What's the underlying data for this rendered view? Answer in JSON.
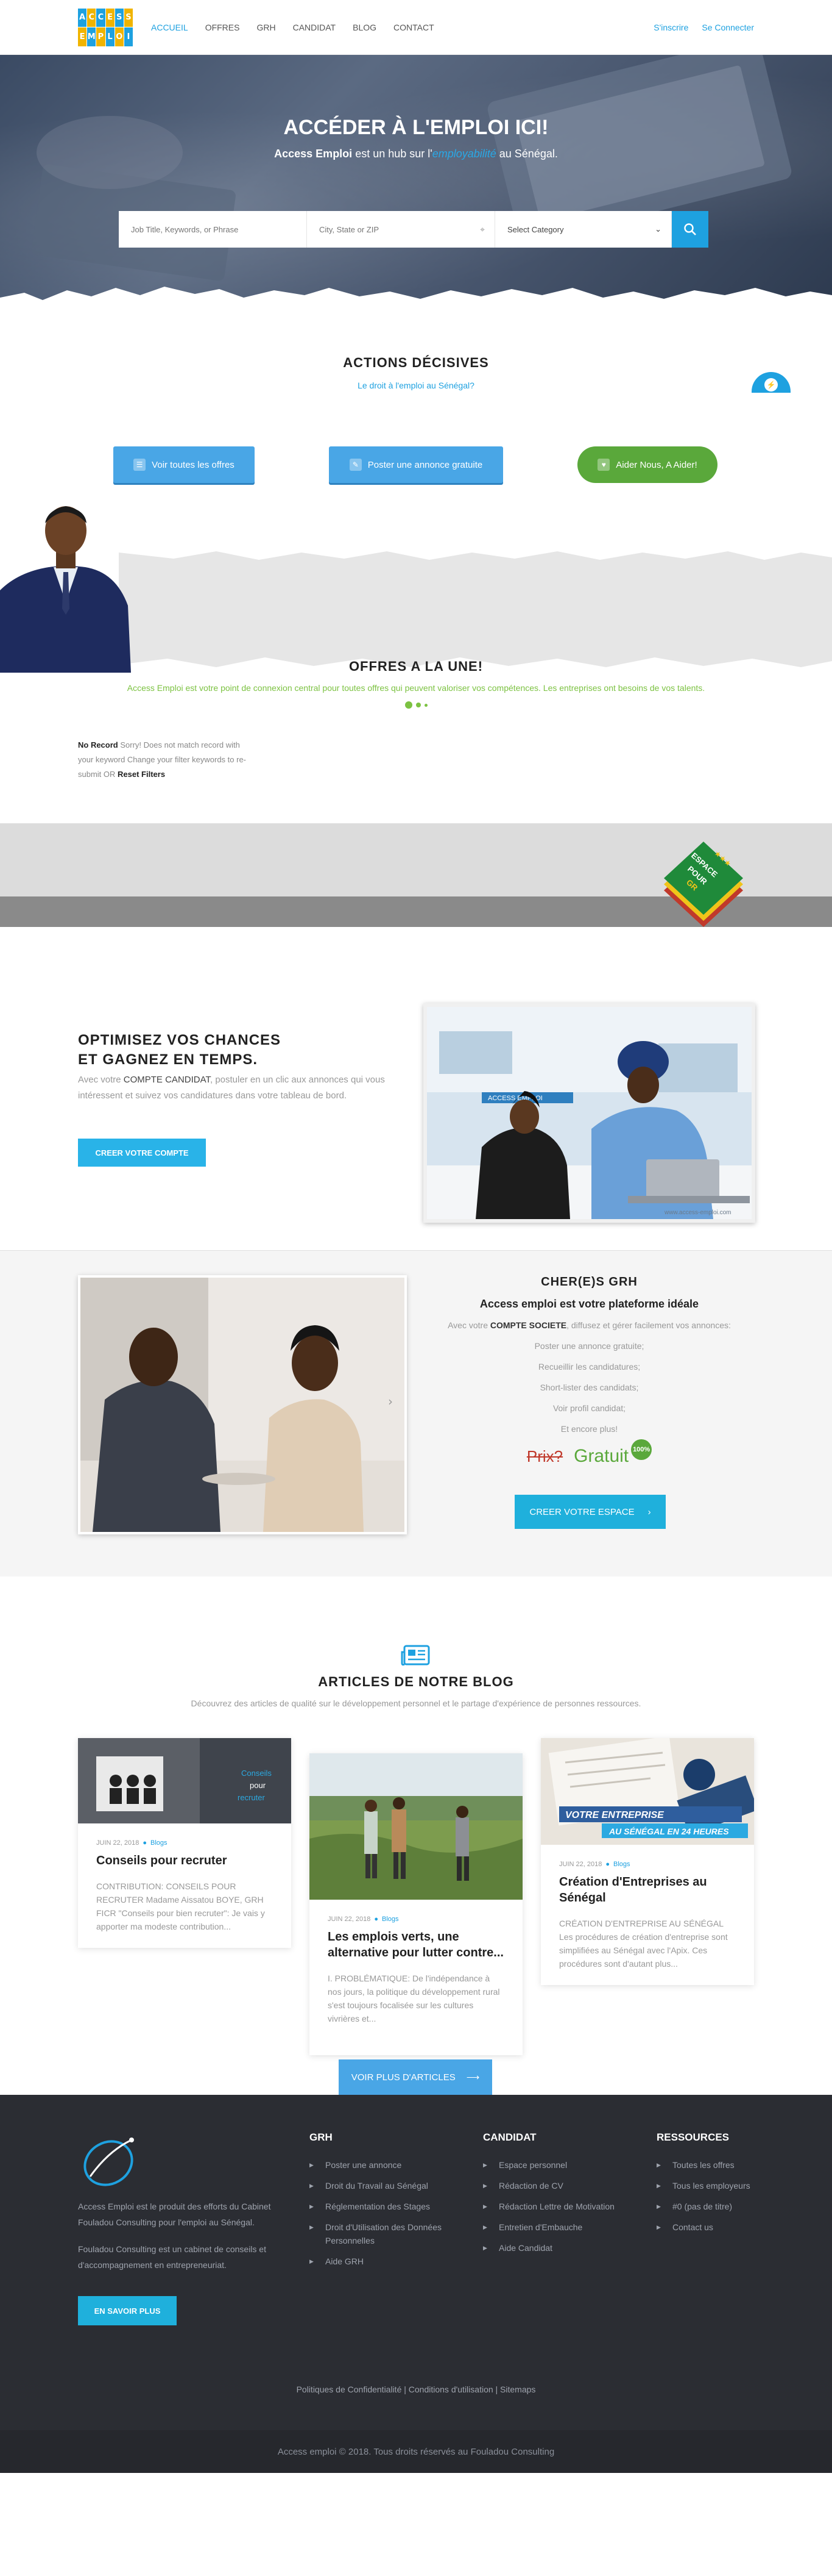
{
  "colors": {
    "accent": "#1ea1e0",
    "green": "#5aa83b",
    "footer": "#2b2d33"
  },
  "logo": {
    "line1": [
      "A",
      "C",
      "C",
      "E",
      "S",
      "S"
    ],
    "line2": [
      "E",
      "M",
      "P",
      "L",
      "O",
      "I"
    ]
  },
  "nav": {
    "items": [
      "ACCUEIL",
      "OFFRES",
      "GRH",
      "CANDIDAT",
      "BLOG",
      "CONTACT"
    ],
    "signup": "S'inscrire",
    "login": "Se Connecter"
  },
  "hero": {
    "title": "ACCÉDER À L'EMPLOI ICI!",
    "sub_brand": "Access Emploi",
    "sub_mid": " est un hub sur l'",
    "sub_hl": "employabilité",
    "sub_end": " au Sénégal.",
    "search": {
      "keywords_placeholder": "Job Title, Keywords, or Phrase",
      "location_placeholder": "City, State or ZIP",
      "category": "Select Category"
    }
  },
  "actions": {
    "title": "ACTIONS DÉCISIVES",
    "link": "Le droit à l'emploi au Sénégal?",
    "buttons": [
      "Voir toutes les offres",
      "Poster une annonce gratuite",
      "Aider Nous, A Aider!"
    ]
  },
  "offres": {
    "title": "OFFRES A LA UNE!",
    "sub": "Access Emploi est votre point de connexion central pour toutes offres qui peuvent valoriser vos compétences. Les entreprises ont besoins de vos talents.",
    "norecord_bold": "No Record",
    "norecord_text": " Sorry! Does not match record with your keyword Change your filter keywords to re-submit OR ",
    "reset": "Reset Filters"
  },
  "espace": {
    "line1": "ESPACE",
    "line2": "POUR",
    "line3": "GR"
  },
  "optim": {
    "title1": "OPTIMISEZ VOS CHANCES",
    "title2": "ET GAGNEZ EN TEMPS.",
    "text_pre": "Avec votre ",
    "text_bold": "COMPTE CANDIDAT",
    "text_post": ", postuler en un clic aux annonces qui vous intéressent et suivez vos candidatures dans votre tableau de bord.",
    "button": "CREER VOTRE COMPTE",
    "img_brand": "ACCESS EMPLOI",
    "img_url": "www.access-emploi.com"
  },
  "grh": {
    "heading": "CHER(E)S GRH",
    "subheading": "Access emploi est votre plateforme idéale",
    "intro_pre": "Avec votre ",
    "intro_bold": "COMPTE SOCIETE",
    "intro_post": ", diffusez et gérer facilement vos annonces:",
    "lines": [
      "Poster une annonce gratuite;",
      "Recueillir les candidatures;",
      "Short-lister des candidats;",
      "Voir profil candidat;",
      "Et encore plus!"
    ],
    "old_price": "Prix?",
    "new_price": "Gratuit",
    "percent": "100%",
    "button": "CREER VOTRE ESPACE"
  },
  "blog": {
    "title": "ARTICLES DE NOTRE BLOG",
    "sub": "Découvrez des articles de qualité sur le développement personnel et le partage d'expérience de personnes ressources.",
    "posts": [
      {
        "date": "JUIN 22, 2018",
        "cat": "Blogs",
        "title": "Conseils pour recruter",
        "excerpt": "CONTRIBUTION: CONSEILS POUR RECRUTER Madame Aissatou BOYE, GRH FICR \"Conseils pour bien recruter\": Je vais y apporter ma modeste contribution...",
        "thumb_text1": "Conseils",
        "thumb_text2": "pour",
        "thumb_text3": "recruter"
      },
      {
        "date": "JUIN 22, 2018",
        "cat": "Blogs",
        "title": "Les emplois verts, une alternative pour lutter contre...",
        "excerpt": "I. PROBLÉMATIQUE: De l'indépendance à nos jours, la politique du développement rural s'est toujours focalisée sur les cultures vivrières et..."
      },
      {
        "date": "JUIN 22, 2018",
        "cat": "Blogs",
        "title": "Création d'Entreprises au Sénégal",
        "excerpt": "CRÉATION D'ENTREPRISE AU SÉNÉGAL Les procédures de création d'entreprise sont simplifiées au Sénégal avec l'Apix. Ces procédures sont d'autant plus...",
        "thumb_text1": "VOTRE ENTREPRISE",
        "thumb_text2": "AU SÉNÉGAL EN 24 HEURES"
      }
    ],
    "more": "VOIR PLUS D'ARTICLES"
  },
  "footer": {
    "about1": "Access Emploi est le produit des efforts du Cabinet Fouladou Consulting pour l'emploi au Sénégal.",
    "about2": "Fouladou Consulting est un cabinet de conseils et d'accompagnement en entrepreneuriat.",
    "button": "EN SAVOIR PLUS",
    "cols": [
      {
        "title": "GRH",
        "items": [
          "Poster une annonce",
          "Droit du Travail au Sénégal",
          "Réglementation des Stages",
          "Droit d'Utilisation des Données Personnelles",
          "Aide GRH"
        ]
      },
      {
        "title": "CANDIDAT",
        "items": [
          "Espace personnel",
          "Rédaction de CV",
          "Rédaction Lettre de Motivation",
          "Entretien d'Embauche",
          "Aide Candidat"
        ]
      },
      {
        "title": "RESSOURCES",
        "items": [
          "Toutes les offres",
          "Tous les employeurs",
          "#0 (pas de titre)",
          "Contact us"
        ]
      }
    ],
    "links": "Politiques de Confidentialité | Conditions d'utilisation | Sitemaps",
    "copyright": "Access emploi © 2018. Tous droits réservés au Fouladou Consulting"
  }
}
